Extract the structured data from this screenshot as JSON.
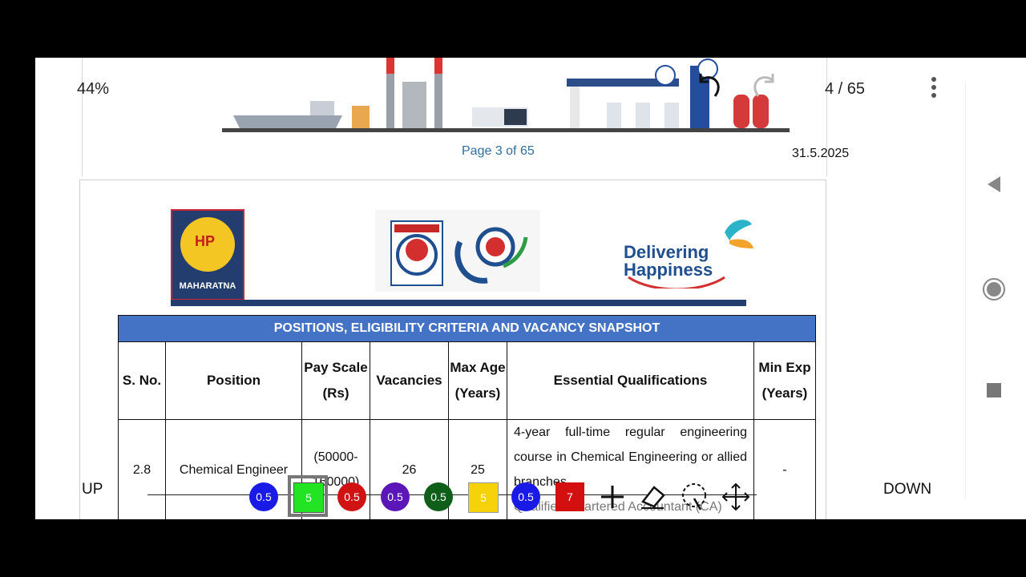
{
  "viewer": {
    "zoom": "44%",
    "page_indicator": "4 / 65",
    "scroll_up": "UP",
    "scroll_down": "DOWN"
  },
  "prev_page": {
    "footer_label": "Page 3 of 65",
    "date": "31.5.2025"
  },
  "doc": {
    "maharatna_label": "MAHARATNA",
    "hp_text": "HP",
    "delivering": "Delivering",
    "happiness": "Happiness",
    "table_title": "POSITIONS, ELIGIBILITY CRITERIA AND VACANCY SNAPSHOT",
    "headers": [
      "S. No.",
      "Position",
      "Pay Scale (Rs)",
      "Vacancies",
      "Max Age (Years)",
      "Essential Qualifications",
      "Min Exp (Years)"
    ],
    "rows": [
      {
        "sno": "2.8",
        "position": "Chemical Engineer",
        "pay": "(50000-160000)",
        "vacancies": "26",
        "age": "25",
        "qualification": "4-year full-time regular engineering course in Chemical Engineering or allied branches",
        "exp": "-"
      }
    ],
    "next_row_partial": "Qualified Chartered Accountant (CA)"
  },
  "pen_toolbar": {
    "pens": [
      {
        "label": "0.5",
        "color": "#1a1ae6",
        "shape": "circle"
      },
      {
        "label": "5",
        "color": "#22e422",
        "shape": "square",
        "selected": true
      },
      {
        "label": "0.5",
        "color": "#d01212",
        "shape": "circle"
      },
      {
        "label": "0.5",
        "color": "#5b16b8",
        "shape": "circle"
      },
      {
        "label": "0.5",
        "color": "#0f5e1a",
        "shape": "circle"
      },
      {
        "label": "5",
        "color": "#f5d20a",
        "shape": "square"
      },
      {
        "label": "0.5",
        "color": "#1a1ae6",
        "shape": "circle"
      },
      {
        "label": "7",
        "color": "#d40f0f",
        "shape": "square"
      }
    ],
    "tools": [
      "add-icon",
      "eraser-icon",
      "lasso-select-icon",
      "move-icon"
    ]
  }
}
